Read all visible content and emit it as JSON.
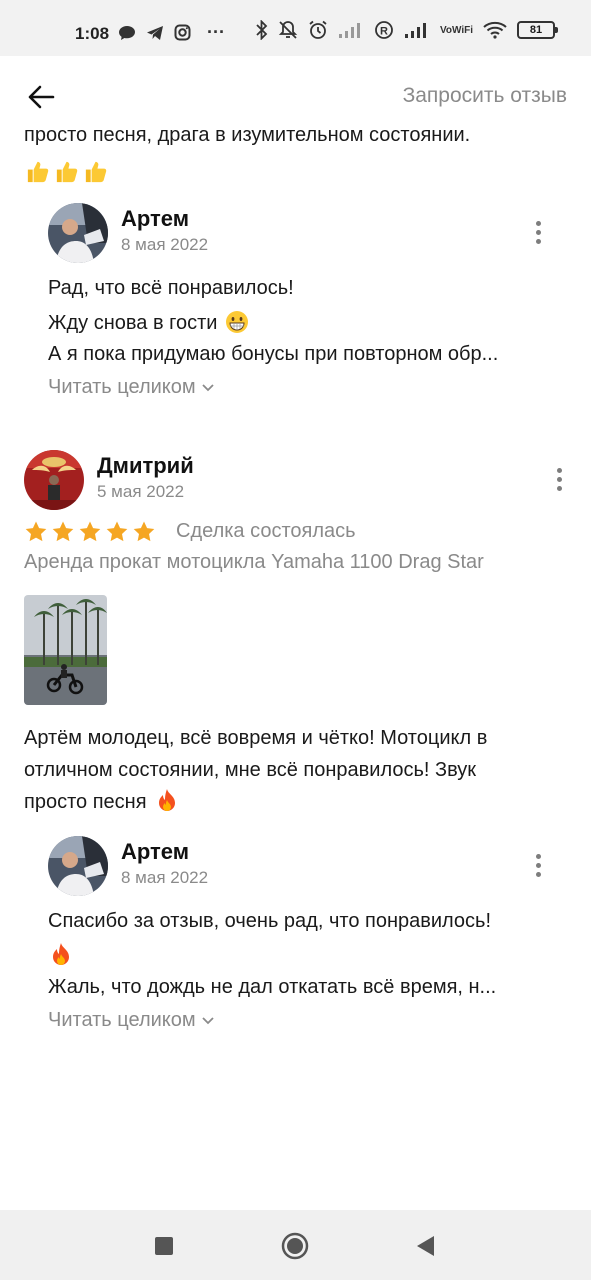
{
  "status_bar": {
    "time": "1:08",
    "dots": "···",
    "vowifi_top": "Vo",
    "vowifi_bottom": "WiFi",
    "battery": "81"
  },
  "header": {
    "request_review": "Запросить отзыв"
  },
  "top_cut": {
    "text": "просто песня, драга в изумительном состоянии."
  },
  "reply1": {
    "author": "Артем",
    "date": "8 мая 2022",
    "lines": [
      "Рад, что всё понравилось!",
      "Жду снова в гости",
      "А я пока придумаю бонусы при повторном обр..."
    ],
    "read_more": "Читать целиком"
  },
  "review2": {
    "author": "Дмитрий",
    "date": "5 мая 2022",
    "rating": 5,
    "deal_status": "Сделка состоялась",
    "product": "Аренда прокат мотоцикла Yamaha 1100 Drag Star",
    "text_lines": [
      "Артём молодец, всё вовремя и чётко! Мотоцикл в",
      "отличном состоянии, мне всё понравилось! Звук",
      "просто песня"
    ]
  },
  "reply2": {
    "author": "Артем",
    "date": "8 мая 2022",
    "lines": [
      "Спасибо за отзыв, очень рад, что понравилось!",
      "Жаль, что дождь не дал откатать всё время, н..."
    ],
    "read_more": "Читать целиком"
  },
  "colors": {
    "accent_star": "#f5a623",
    "secondary_text": "#8a8a8a",
    "primary_text": "#1a1a1a"
  },
  "icons": {
    "back": "arrow-left-icon",
    "more": "more-vertical-icon",
    "chevron": "chevron-down-icon",
    "star": "star-icon",
    "nav_recent": "square-icon",
    "nav_home": "circle-icon",
    "nav_back": "triangle-back-icon"
  }
}
